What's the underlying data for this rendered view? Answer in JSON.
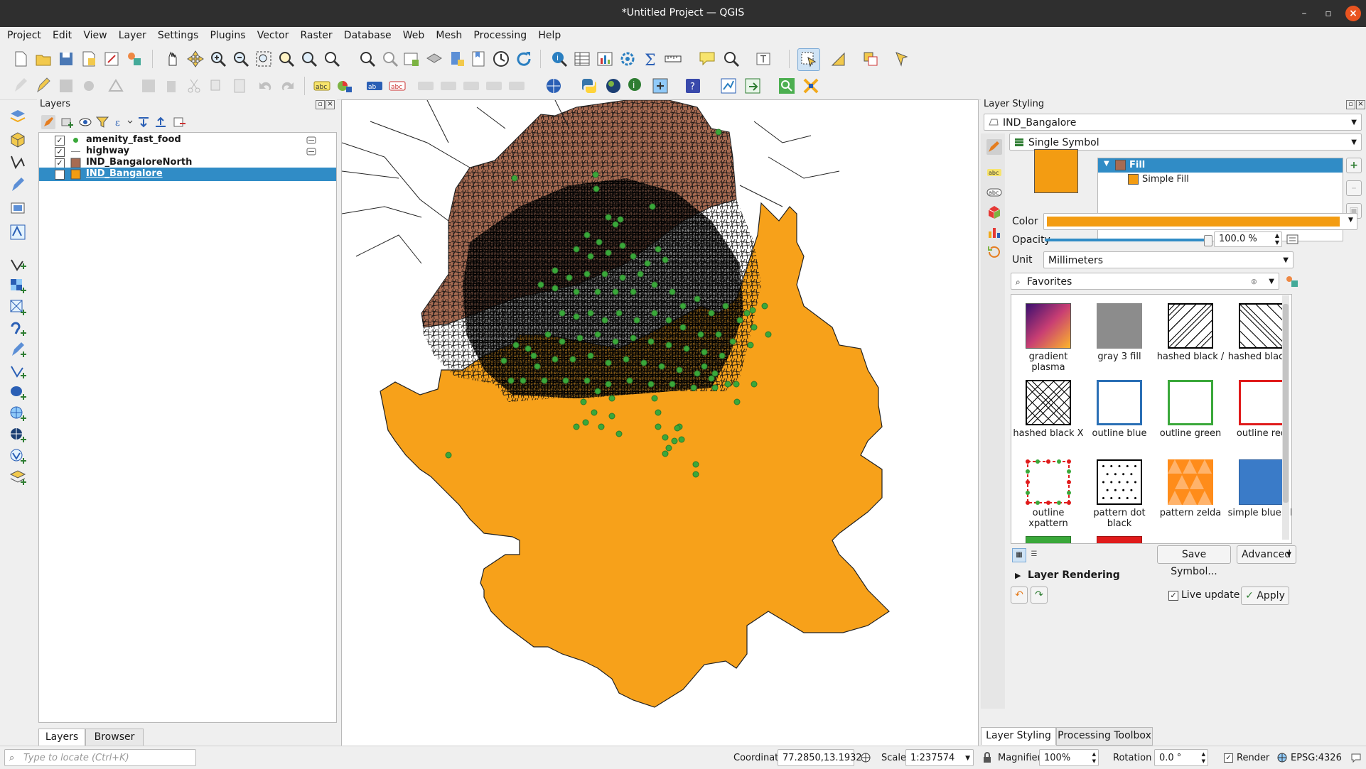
{
  "window": {
    "title": "*Untitled Project — QGIS",
    "close": "×",
    "minimize": "–",
    "maximize": "▫"
  },
  "menu": [
    "Project",
    "Edit",
    "View",
    "Layer",
    "Settings",
    "Plugins",
    "Vector",
    "Raster",
    "Database",
    "Web",
    "Mesh",
    "Processing",
    "Help"
  ],
  "layers_panel": {
    "title": "Layers",
    "items": [
      {
        "label": "amenity_fast_food",
        "checked": true,
        "symbol": "point",
        "color": "#3aa83a"
      },
      {
        "label": "highway",
        "checked": true,
        "symbol": "line",
        "color": "#888888"
      },
      {
        "label": "IND_BangaloreNorth",
        "checked": true,
        "symbol": "fill",
        "color": "#a76b52"
      },
      {
        "label": "IND_Bangalore",
        "checked": true,
        "symbol": "fill",
        "color": "#f39c12",
        "selected": true
      }
    ],
    "tabs": [
      "Layers",
      "Browser"
    ],
    "locator_placeholder": "Type to locate (Ctrl+K)"
  },
  "styling_panel": {
    "title": "Layer Styling",
    "layer": "IND_Bangalore",
    "renderer": "Single Symbol",
    "tree": {
      "root": "Fill",
      "child": "Simple Fill"
    },
    "symbol_color": "#f39c12",
    "color_label": "Color",
    "opacity_label": "Opacity",
    "opacity_value": "100.0 %",
    "unit_label": "Unit",
    "unit_value": "Millimeters",
    "library_filter": "Favorites",
    "swatches": [
      {
        "label": "gradient plasma"
      },
      {
        "label": "gray 3 fill"
      },
      {
        "label": "hashed black /"
      },
      {
        "label": "hashed black \\"
      },
      {
        "label": "hashed black X"
      },
      {
        "label": "outline blue"
      },
      {
        "label": "outline green"
      },
      {
        "label": "outline red"
      },
      {
        "label": "outline xpattern"
      },
      {
        "label": "pattern dot black"
      },
      {
        "label": "pattern zelda"
      },
      {
        "label": "simple blue fill"
      }
    ],
    "save_symbol": "Save Symbol...",
    "advanced": "Advanced",
    "layer_rendering": "Layer Rendering",
    "live_update": "Live update",
    "apply": "Apply",
    "tabs": [
      "Layer Styling",
      "Processing Toolbox"
    ]
  },
  "map": {
    "north_color": "#a76b52",
    "south_color": "#f39c12",
    "point_color": "#3aa83a"
  },
  "status": {
    "coordinate_label": "Coordinate",
    "coordinate": "77.2850,13.1932",
    "scale_label": "Scale",
    "scale": "1:237574",
    "magnifier_label": "Magnifier",
    "magnifier": "100%",
    "rotation_label": "Rotation",
    "rotation": "0.0 °",
    "render_label": "Render",
    "crs": "EPSG:4326"
  }
}
